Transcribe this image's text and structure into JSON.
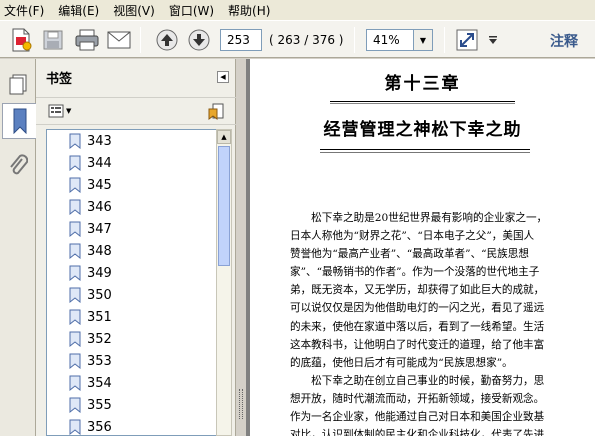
{
  "menu": [
    {
      "label": "文件(F)"
    },
    {
      "label": "编辑(E)"
    },
    {
      "label": "视图(V)"
    },
    {
      "label": "窗口(W)"
    },
    {
      "label": "帮助(H)"
    }
  ],
  "toolbar": {
    "current_page": "253",
    "page_count": "( 263 / 376 )",
    "zoom": "41%",
    "annotate_label": "注释",
    "icons": [
      "create-pdf-icon",
      "save-icon",
      "print-icon",
      "email-icon",
      "previous-page-icon",
      "next-page-icon",
      "fit-window-icon",
      "more-tools-icon"
    ]
  },
  "sidebar_tabs": [
    "pages-icon",
    "bookmarks-icon",
    "attachments-icon"
  ],
  "bookmarks": {
    "title": "书签",
    "items": [
      "343",
      "344",
      "345",
      "346",
      "347",
      "348",
      "349",
      "350",
      "351",
      "352",
      "353",
      "354",
      "355",
      "356"
    ]
  },
  "document": {
    "chapter_number": "第十三章",
    "chapter_title": "经营管理之神松下幸之助",
    "lines": [
      "　　松下幸之助是20世纪世界最有影响的企业家之一，",
      "日本人称他为“财界之花”、“日本电子之父”，美国人",
      "赞誉他为“最高产业者”、“最高政革者”、“民族思想",
      "家”、“最畅销书的作者”。作为一个没落的世代地主子",
      "弟，既无资本，又无学历，却获得了如此巨大的成就，",
      "可以说仅仅是因为他借助电灯的一闪之光，看见了遥远",
      "的未来，使他在家道中落以后，看到了一线希望。生活",
      "这本教科书，让他明白了时代变迁的道理，给了他丰富",
      "的底蕴，使他日后才有可能成为“民族思想家”。",
      "　　松下幸之助在创立自己事业的时候，勤奋努力，思",
      "想开放，随时代潮流而动，开拓新领域，接受新观念。",
      "作为一名企业家，他能通过自己对日本和美国企业致基",
      "对比，认识到体制的民主化和企业科技化，代表了先进"
    ]
  }
}
